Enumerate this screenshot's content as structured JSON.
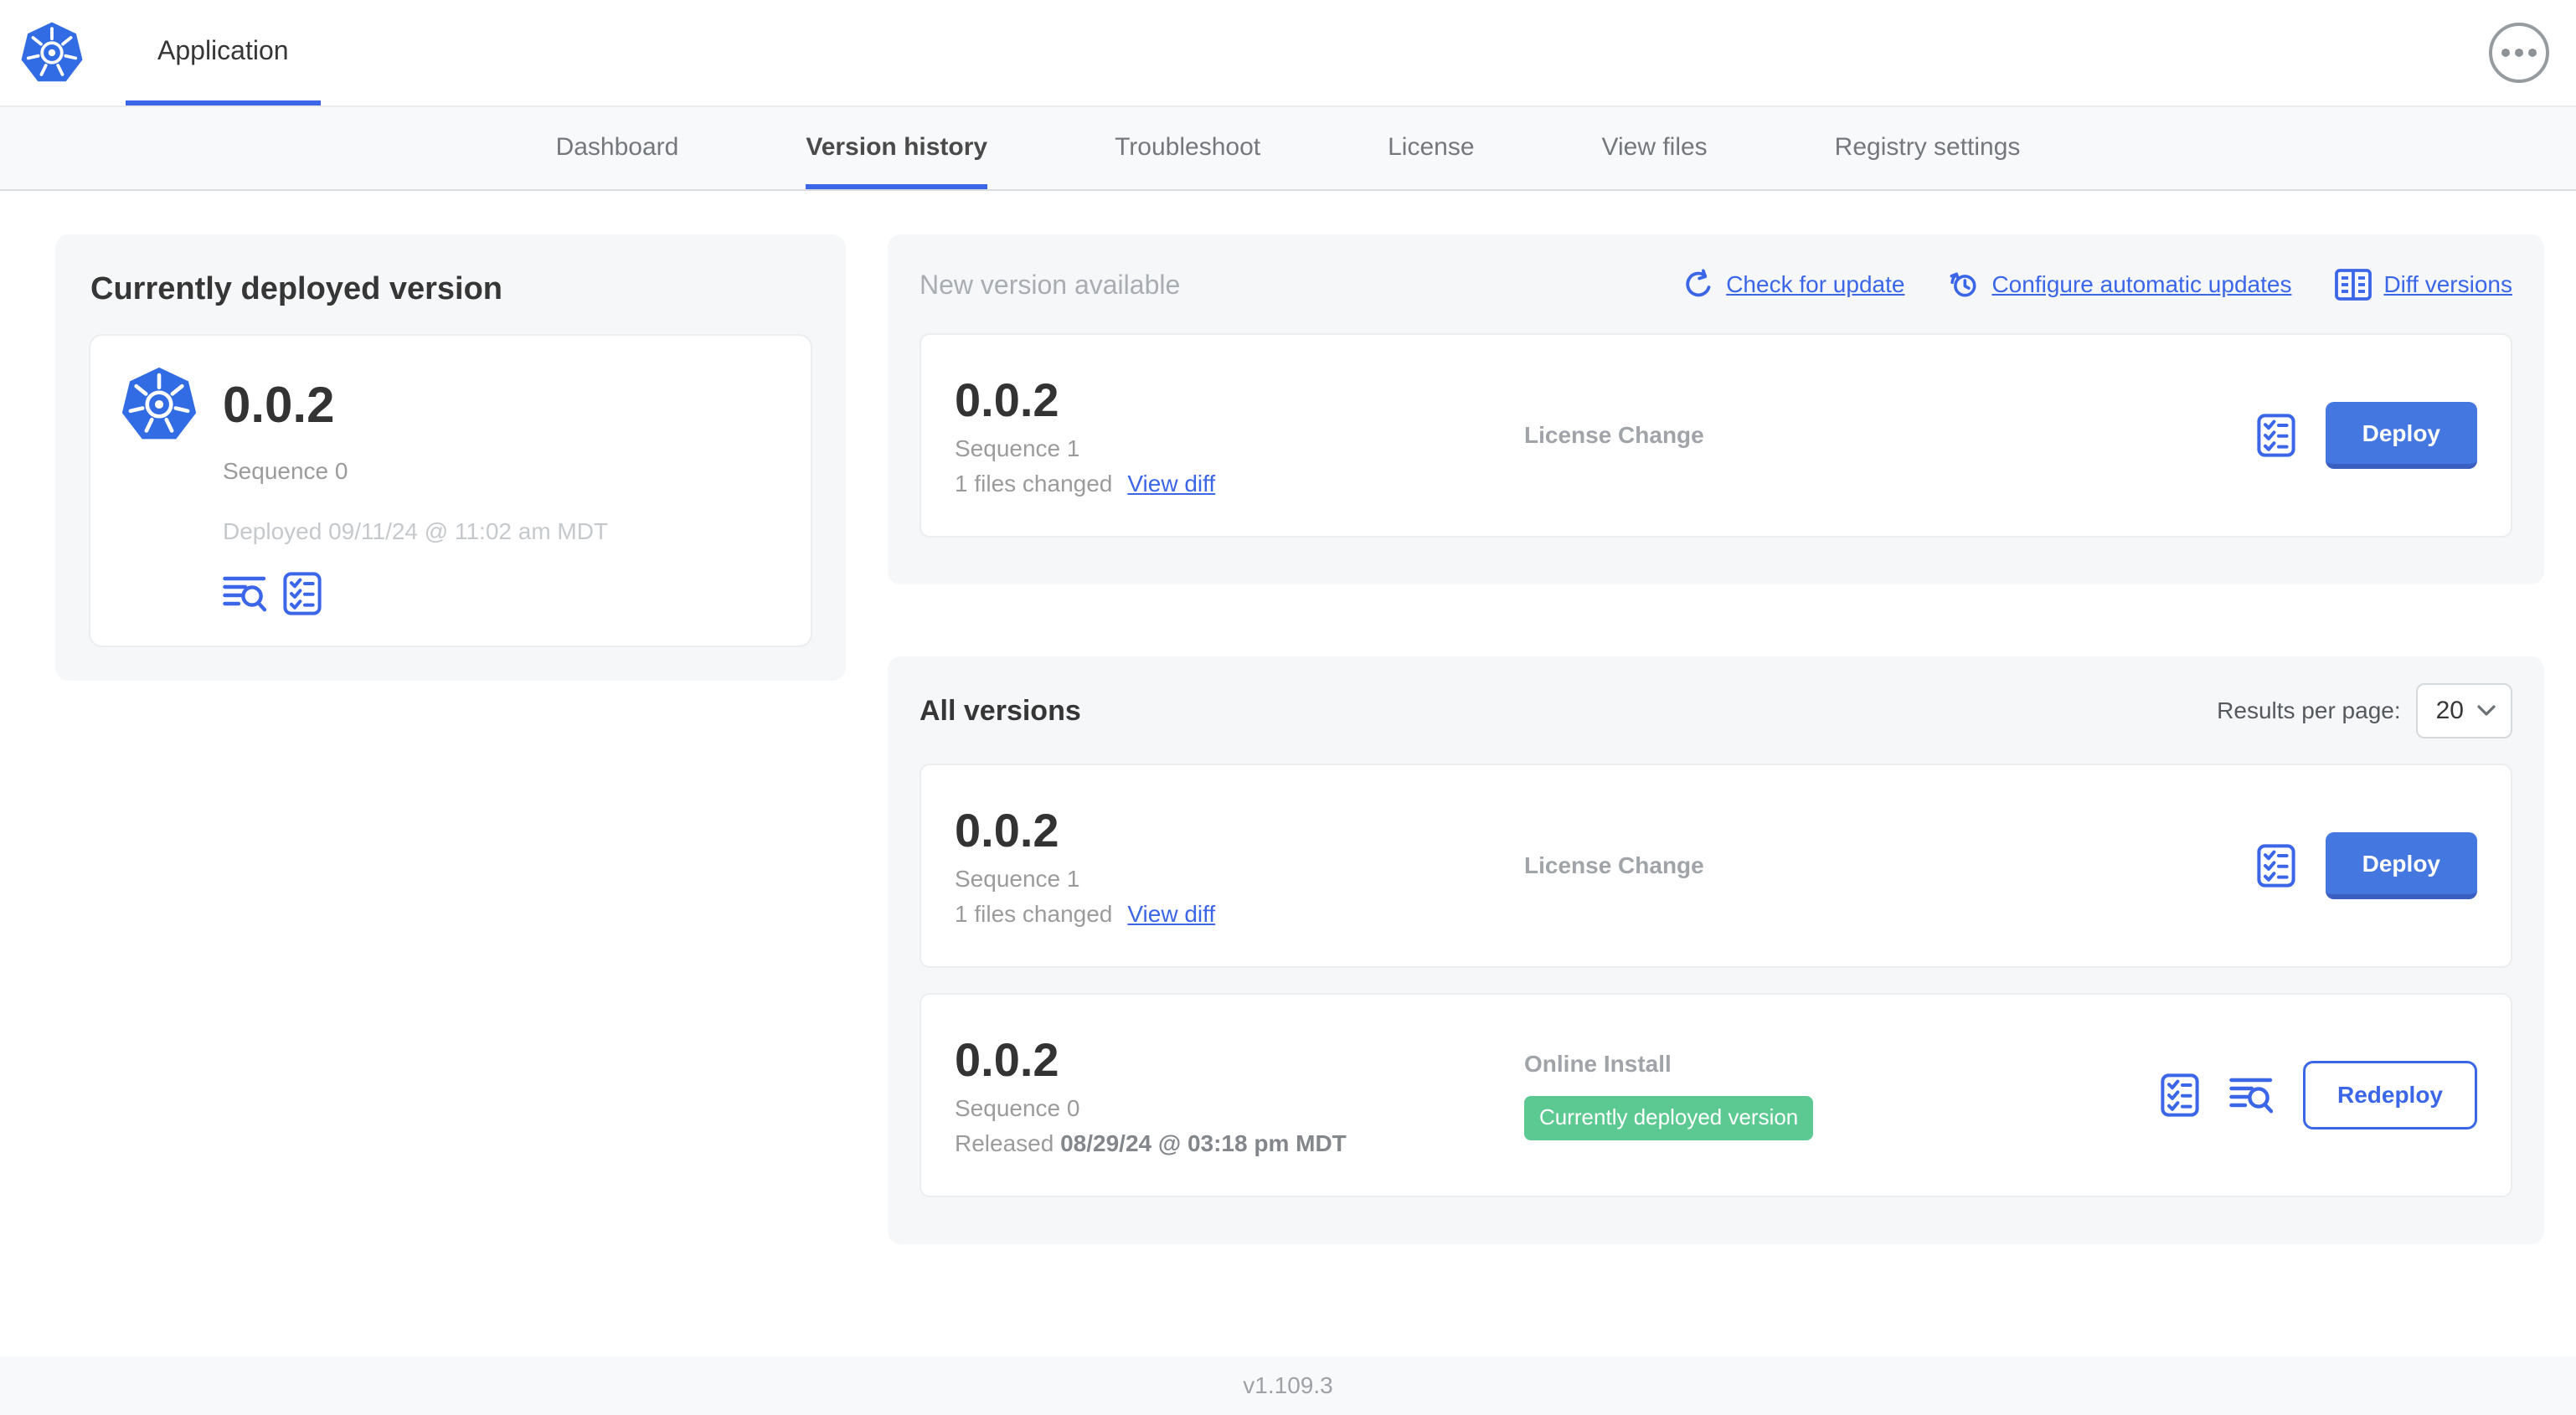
{
  "header": {
    "app_title": "Application"
  },
  "nav": {
    "tabs": [
      {
        "label": "Dashboard",
        "active": false
      },
      {
        "label": "Version history",
        "active": true
      },
      {
        "label": "Troubleshoot",
        "active": false
      },
      {
        "label": "License",
        "active": false
      },
      {
        "label": "View files",
        "active": false
      },
      {
        "label": "Registry settings",
        "active": false
      }
    ]
  },
  "current": {
    "title": "Currently deployed version",
    "version": "0.0.2",
    "sequence": "Sequence 0",
    "deployed": "Deployed 09/11/24 @ 11:02 am MDT"
  },
  "new_version": {
    "title": "New version available",
    "actions": [
      {
        "label": "Check for update",
        "icon": "refresh-icon"
      },
      {
        "label": "Configure automatic updates",
        "icon": "schedule-icon"
      },
      {
        "label": "Diff versions",
        "icon": "diff-icon"
      }
    ],
    "row": {
      "version": "0.0.2",
      "sequence": "Sequence 1",
      "files_changed": "1 files changed",
      "view_diff_label": "View diff",
      "source": "License Change",
      "action_label": "Deploy"
    }
  },
  "all_versions": {
    "title": "All versions",
    "results_per_page_label": "Results per page:",
    "results_per_page_value": "20",
    "rows": [
      {
        "version": "0.0.2",
        "sequence": "Sequence 1",
        "files_changed": "1 files changed",
        "view_diff_label": "View diff",
        "source": "License Change",
        "action_label": "Deploy"
      },
      {
        "version": "0.0.2",
        "sequence": "Sequence 0",
        "released_prefix": "Released",
        "released_date": "08/29/24 @ 03:18 pm MDT",
        "source": "Online Install",
        "badge": "Currently deployed version",
        "action_label": "Redeploy"
      }
    ]
  },
  "footer": {
    "version": "v1.109.3"
  },
  "colors": {
    "accent_blue": "#3b66e8",
    "button_blue": "#4577e0",
    "button_blue_dark": "#3a5fc0",
    "badge_green": "#5cc992",
    "k8s_logo_blue": "#326ce5",
    "panel_gray": "#f5f7f8",
    "nav_gray": "#f8f9fa"
  }
}
